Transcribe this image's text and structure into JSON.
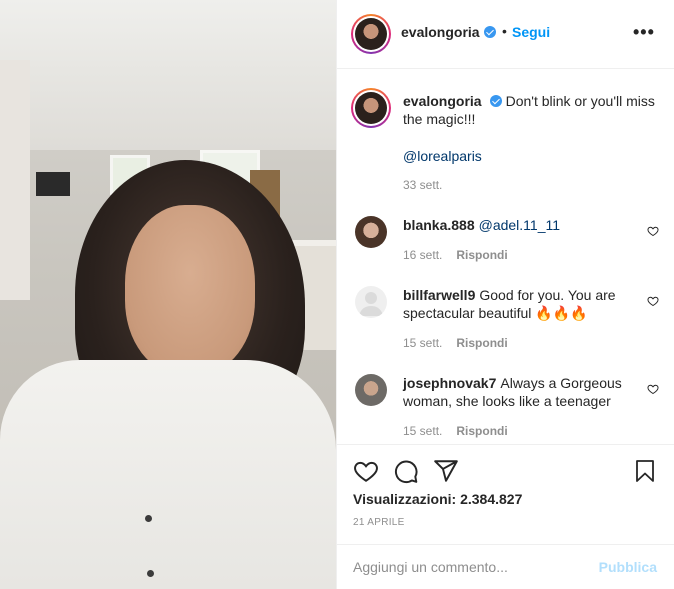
{
  "post": {
    "author": "evalongoria",
    "follow_label": "Segui",
    "separator": "•",
    "more_label": "•••"
  },
  "caption": {
    "author": "evalongoria",
    "text": "Don't blink or you'll miss the magic!!!",
    "mention": "@lorealparis",
    "time": "33 sett."
  },
  "comments": [
    {
      "author": "blanka.888",
      "text": "@adel.11_11",
      "time": "16 sett.",
      "reply_label": "Rispondi"
    },
    {
      "author": "billfarwell9",
      "text": "Good for you. You are spectacular beautiful 🔥🔥🔥",
      "time": "15 sett.",
      "reply_label": "Rispondi"
    },
    {
      "author": "josephnovak7",
      "text": "Always a Gorgeous woman, she looks like a teenager",
      "time": "15 sett.",
      "reply_label": "Rispondi"
    }
  ],
  "stats": {
    "views": "Visualizzazioni: 2.384.827",
    "date": "21 APRILE"
  },
  "add_comment": {
    "placeholder": "Aggiungi un commento...",
    "publish_label": "Pubblica"
  },
  "icons": [
    "verified-badge-icon",
    "more-options-icon",
    "heart-icon",
    "comment-icon",
    "share-icon",
    "bookmark-icon"
  ],
  "colors": {
    "link": "#0095f6",
    "mention": "#00376b",
    "publish_disabled": "#b2dffc",
    "muted": "#8e8e8e"
  }
}
